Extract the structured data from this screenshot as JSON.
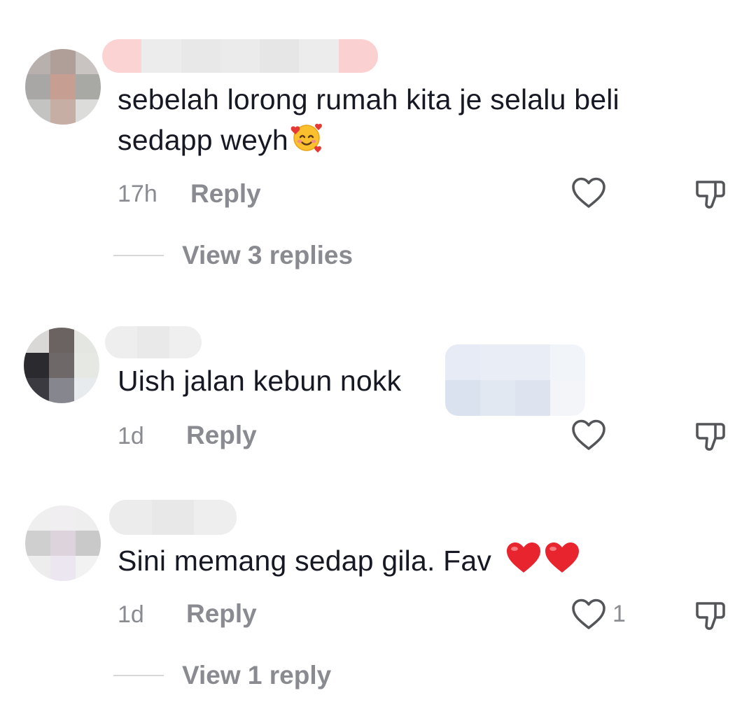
{
  "comments": [
    {
      "text": "sebelah lorong rumah kita je selalu beli",
      "text_line2": "sedapp weyh",
      "emoji": "smiling-face-with-hearts",
      "time": "17h",
      "reply_label": "Reply",
      "view_replies_label": "View 3 replies"
    },
    {
      "text": "Uish jalan kebun nokk",
      "time": "1d",
      "reply_label": "Reply"
    },
    {
      "text": "Sini memang sedap gila. Fav ",
      "emoji": "red-heart x2",
      "time": "1d",
      "reply_label": "Reply",
      "like_count": "1",
      "view_replies_label": "View 1 reply"
    }
  ],
  "colors": {
    "text": "#161823",
    "secondary": "#8a8b91",
    "divider": "#d7d8da",
    "heart_red": "#e8242f"
  },
  "icons": {
    "like": "heart-outline-icon",
    "dislike": "thumbs-down-outline-icon"
  }
}
